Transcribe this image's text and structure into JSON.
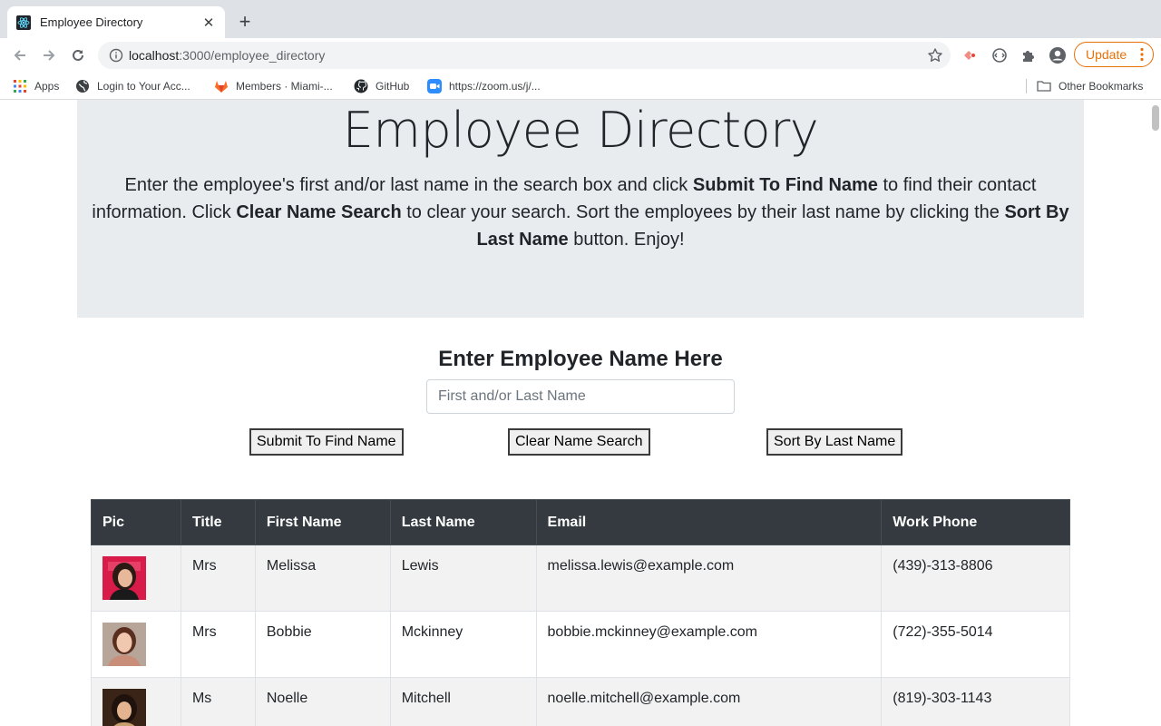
{
  "browser": {
    "tab_title": "Employee Directory",
    "url_host": "localhost",
    "url_path": ":3000/employee_directory",
    "update_label": "Update",
    "bookmarks": [
      {
        "label": "Apps",
        "icon": "apps-grid-icon"
      },
      {
        "label": "Login to Your Acc...",
        "icon": "globe-icon"
      },
      {
        "label": "Members · Miami-...",
        "icon": "gitlab-icon"
      },
      {
        "label": "GitHub",
        "icon": "github-icon"
      },
      {
        "label": "https://zoom.us/j/...",
        "icon": "zoom-icon"
      }
    ],
    "other_bookmarks": "Other Bookmarks"
  },
  "page": {
    "title": "Employee Directory",
    "intro": {
      "p1": "Enter the employee's first and/or last name in the search box and click ",
      "b1": "Submit To Find Name",
      "p2": " to find their contact information. Click ",
      "b2": "Clear Name Search",
      "p3": " to clear your search. Sort the employees by their last name by clicking the ",
      "b3": "Sort By Last Name",
      "p4": " button. Enjoy!"
    },
    "search_heading": "Enter Employee Name Here",
    "search_placeholder": "First and/or Last Name",
    "buttons": {
      "submit": "Submit To Find Name",
      "clear": "Clear Name Search",
      "sort": "Sort By Last Name"
    },
    "table": {
      "headers": [
        "Pic",
        "Title",
        "First Name",
        "Last Name",
        "Email",
        "Work Phone"
      ],
      "rows": [
        {
          "title": "Mrs",
          "first": "Melissa",
          "last": "Lewis",
          "email": "melissa.lewis@example.com",
          "phone": "(439)-313-8806"
        },
        {
          "title": "Mrs",
          "first": "Bobbie",
          "last": "Mckinney",
          "email": "bobbie.mckinney@example.com",
          "phone": "(722)-355-5014"
        },
        {
          "title": "Ms",
          "first": "Noelle",
          "last": "Mitchell",
          "email": "noelle.mitchell@example.com",
          "phone": "(819)-303-1143"
        }
      ]
    }
  },
  "colors": {
    "jumbotron_bg": "#e9ecef",
    "table_header_bg": "#343a40",
    "update_accent": "#e8710a"
  }
}
